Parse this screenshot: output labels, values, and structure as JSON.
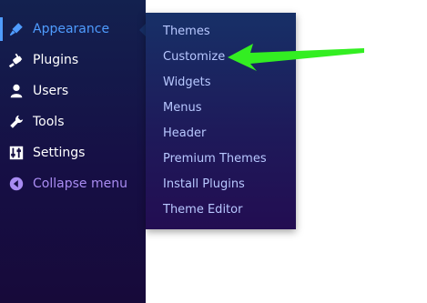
{
  "sidebar": {
    "items": [
      {
        "label": "Appearance",
        "icon": "paintbrush-icon"
      },
      {
        "label": "Plugins",
        "icon": "plugin-icon"
      },
      {
        "label": "Users",
        "icon": "user-icon"
      },
      {
        "label": "Tools",
        "icon": "wrench-icon"
      },
      {
        "label": "Settings",
        "icon": "settings-sliders-icon"
      },
      {
        "label": "Collapse menu",
        "icon": "collapse-arrow-icon"
      }
    ]
  },
  "submenu": {
    "items": [
      {
        "label": "Themes"
      },
      {
        "label": "Customize"
      },
      {
        "label": "Widgets"
      },
      {
        "label": "Menus"
      },
      {
        "label": "Header"
      },
      {
        "label": "Premium Themes"
      },
      {
        "label": "Install Plugins"
      },
      {
        "label": "Theme Editor"
      }
    ]
  },
  "colors": {
    "sidebar_bg": "#160f45",
    "submenu_bg": "#1e1a5a",
    "active_accent": "#4f9cff",
    "submenu_text": "#b8c8ff",
    "collapse_text": "#a98cf2",
    "annotation_arrow": "#33ee22"
  }
}
